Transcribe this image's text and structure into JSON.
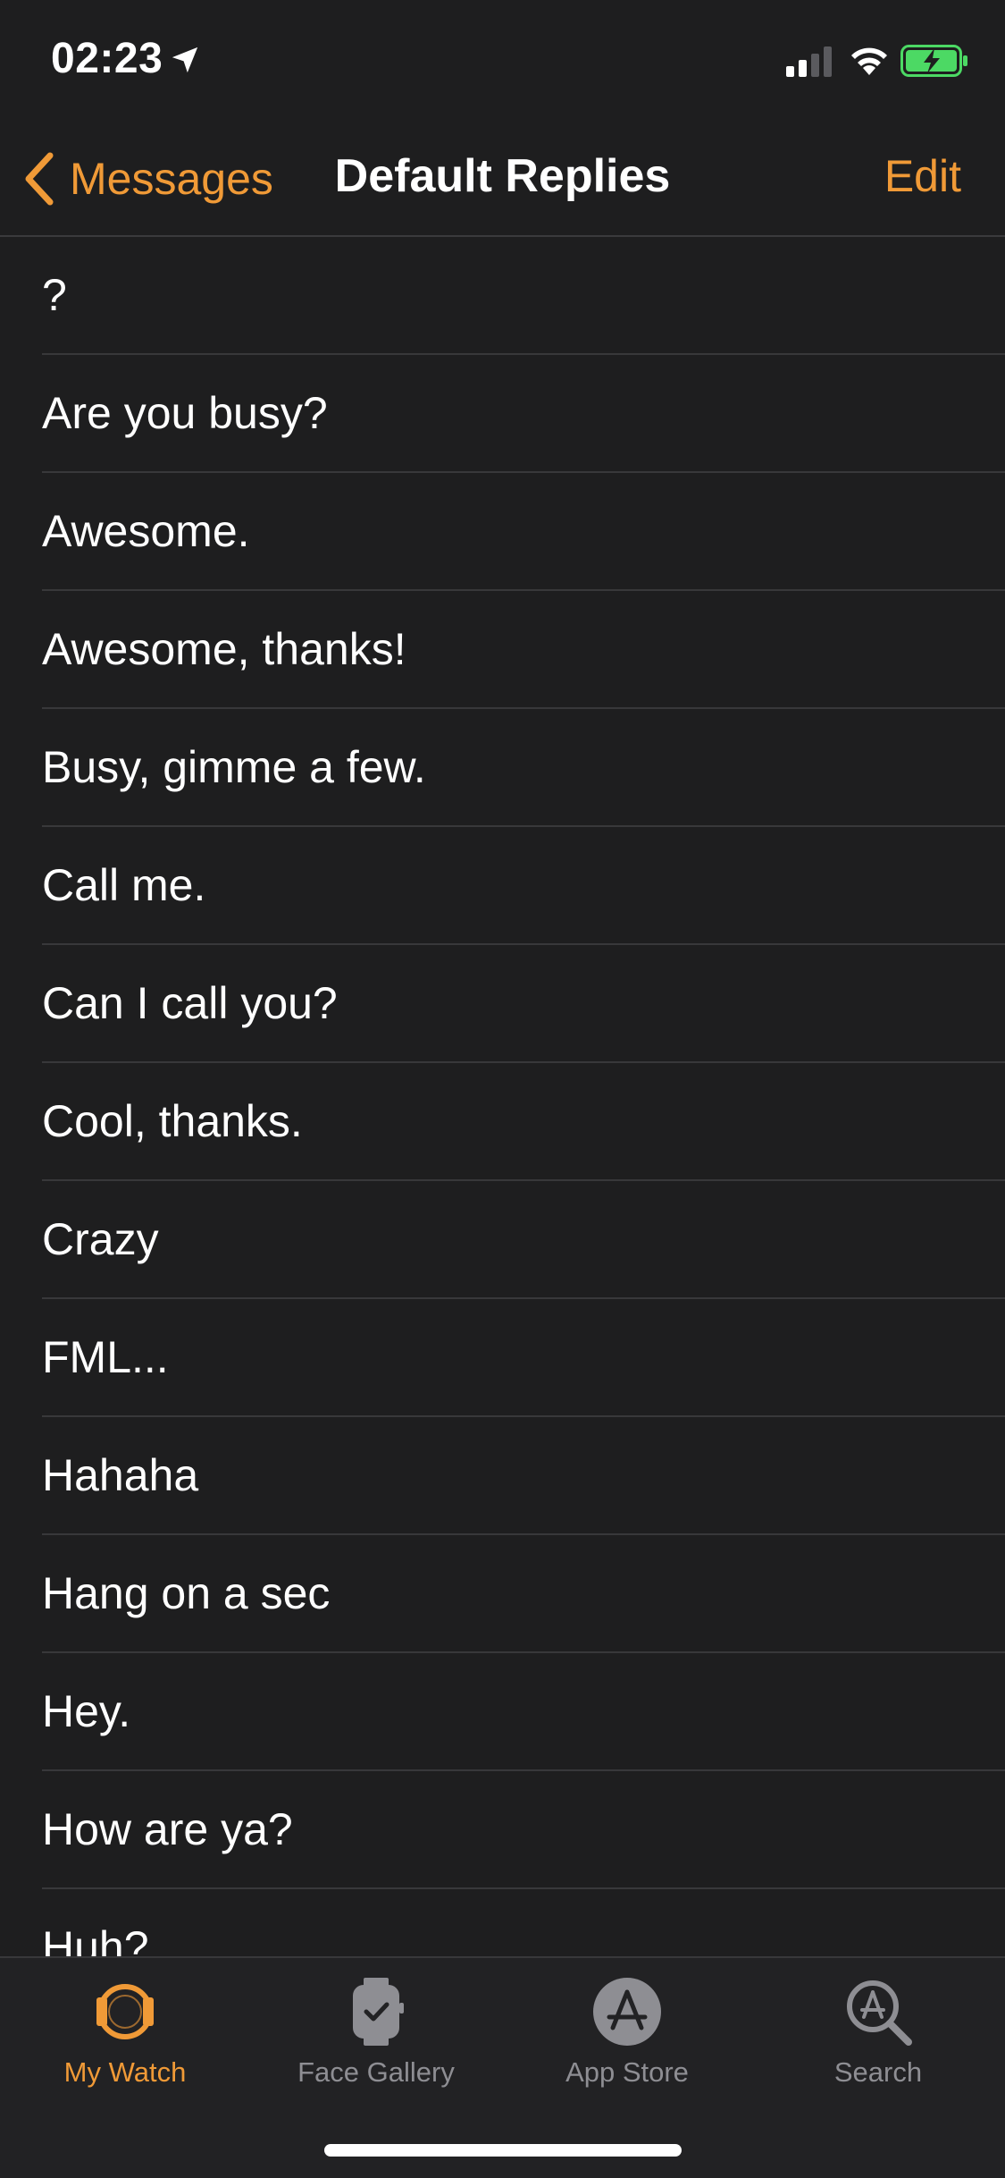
{
  "status_bar": {
    "time": "02:23",
    "icons": [
      "location-arrow-icon",
      "cellular-signal-icon",
      "wifi-icon",
      "battery-charging-icon"
    ]
  },
  "nav": {
    "back_label": "Messages",
    "title": "Default Replies",
    "edit_label": "Edit"
  },
  "colors": {
    "accent": "#f09a37",
    "background": "#1e1e1f",
    "separator": "#38383a",
    "inactive": "#8e8e93",
    "battery": "#4cd964"
  },
  "replies": [
    "?",
    "Are you busy?",
    "Awesome.",
    "Awesome, thanks!",
    "Busy, gimme a few.",
    "Call me.",
    "Can I call you?",
    "Cool, thanks.",
    "Crazy",
    "FML...",
    "Hahaha",
    "Hang on a sec",
    "Hey.",
    "How are ya?",
    "Huh?"
  ],
  "tabs": [
    {
      "label": "My Watch",
      "icon": "my-watch-icon",
      "active": true
    },
    {
      "label": "Face Gallery",
      "icon": "face-gallery-icon",
      "active": false
    },
    {
      "label": "App Store",
      "icon": "app-store-icon",
      "active": false
    },
    {
      "label": "Search",
      "icon": "search-icon",
      "active": false
    }
  ]
}
